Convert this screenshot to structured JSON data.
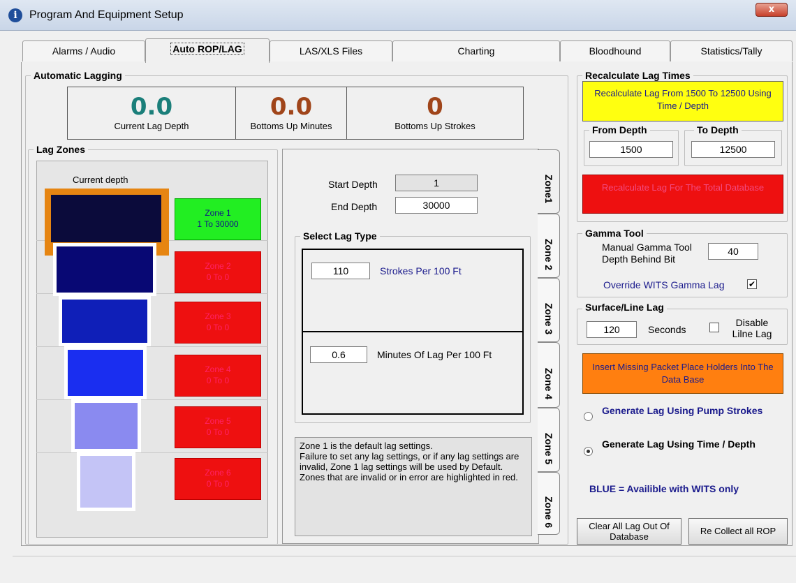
{
  "window": {
    "title": "Program And Equipment Setup",
    "close_label": "x"
  },
  "tabs": [
    "Alarms / Audio",
    "Auto ROP/LAG",
    "LAS/XLS Files",
    "Charting",
    "Bloodhound",
    "Statistics/Tally"
  ],
  "active_tab": "Auto ROP/LAG",
  "auto_lag": {
    "title": "Automatic Lagging",
    "current_lag_depth": {
      "value": "0.0",
      "label": "Current Lag Depth",
      "color": "#1b7f7a"
    },
    "bottoms_up_minutes": {
      "value": "0.0",
      "label": "Bottoms Up Minutes",
      "color": "#a0451a"
    },
    "bottoms_up_strokes": {
      "value": "0",
      "label": "Bottoms Up Strokes",
      "color": "#a0451a"
    }
  },
  "lag_zones": {
    "title": "Lag Zones",
    "current_depth_label": "Current depth",
    "zones": [
      {
        "line1": "Zone 1",
        "line2": "1 To 30000",
        "status": "valid"
      },
      {
        "line1": "Zone 2",
        "line2": "0 To 0",
        "status": "error"
      },
      {
        "line1": "Zone 3",
        "line2": "0 To 0",
        "status": "error"
      },
      {
        "line1": "Zone 4",
        "line2": "0 To 0",
        "status": "error"
      },
      {
        "line1": "Zone 5",
        "line2": "0 To 0",
        "status": "error"
      },
      {
        "line1": "Zone 6",
        "line2": "0 To 0",
        "status": "error"
      }
    ],
    "block_colors": [
      "#0b0b3b",
      "#080874",
      "#0f1fb8",
      "#1a2ef0",
      "#8a8af0",
      "#c4c4f6"
    ]
  },
  "zone_detail": {
    "start_depth_label": "Start Depth",
    "start_depth_value": "1",
    "end_depth_label": "End Depth",
    "end_depth_value": "30000",
    "select_lag_type": "Select Lag Type",
    "strokes_value": "110",
    "strokes_label": "Strokes Per 100 Ft",
    "minutes_value": "0.6",
    "minutes_label": "Minutes Of Lag Per 100 Ft",
    "note": "Zone 1 is the default lag settings.\nFailure to set any lag settings, or if any lag settings are invalid, Zone 1 lag settings will be used by Default.  Zones that are invalid or in error are highlighted in red.",
    "side_tabs": [
      "Zone1",
      "Zone 2",
      "Zone 3",
      "Zone 4",
      "Zone 5",
      "Zone 6"
    ]
  },
  "recalc": {
    "title": "Recalculate Lag Times",
    "recalc_range_button": "Recalculate Lag From 1500 To 12500 Using Time / Depth",
    "from_depth_label": "From Depth",
    "from_depth_value": "1500",
    "to_depth_label": "To Depth",
    "to_depth_value": "12500",
    "recalc_total_button": "Recalculate Lag For The Total Database"
  },
  "gamma": {
    "title": "Gamma Tool",
    "label": "Manual Gamma Tool Depth Behind Bit",
    "value": "40",
    "override_label": "Override WITS Gamma Lag",
    "override_checked": true
  },
  "surface": {
    "title": "Surface/Line Lag",
    "value": "120",
    "seconds_label": "Seconds",
    "disable_label": "Disable Lilne Lag",
    "disable_checked": false
  },
  "insert_button": "Insert Missing Packet Place Holders Into The Data Base",
  "lag_mode": {
    "pump_strokes_label": "Generate Lag Using Pump Strokes",
    "time_depth_label": "Generate Lag Using Time / Depth",
    "selected": "time_depth"
  },
  "wits_note": "BLUE = Availible with WITS only",
  "clear_button": "Clear All Lag Out Of Database",
  "recollect_button": "Re Collect all ROP"
}
